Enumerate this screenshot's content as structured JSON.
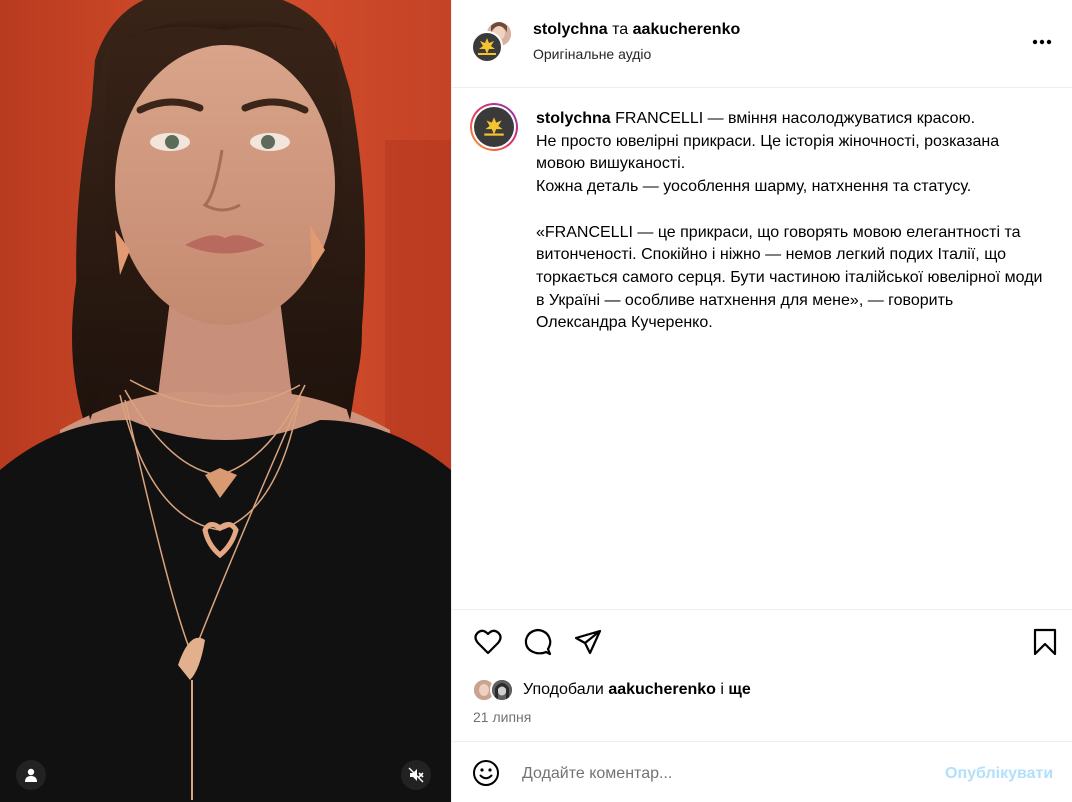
{
  "header": {
    "author": "stolychna",
    "conjunction": "та",
    "coauthor": "aakucherenko",
    "audio": "Оригінальне аудіо"
  },
  "caption": {
    "username": "stolychna",
    "lines1": [
      "FRANCELLI — вміння насолоджуватися красою.",
      "Не просто ювелірні прикраси. Це історія жіночності, розказана мовою вишуканості.",
      "Кожна деталь — уособлення шарму, натхнення та статусу."
    ],
    "quote": "«FRANCELLI — це прикраси, що говорять мовою елегантності та витонченості. Спокійно і ніжно — немов легкий подих Італії, що торкається самого серця. Бути частиною італійської ювелірної моди в Україні — особливе натхнення для мене», — говорить Олександра Кучеренко."
  },
  "likes": {
    "prefix": "Уподобали",
    "user": "aakucherenko",
    "and": "і",
    "more": "ще"
  },
  "date": "21 липня",
  "comment": {
    "placeholder": "Додайте коментар...",
    "publish": "Опублікувати"
  },
  "icons": {
    "like": "heart-icon",
    "comment": "comment-icon",
    "share": "share-icon",
    "save": "bookmark-icon",
    "emoji": "emoji-icon",
    "more": "more-icon",
    "user": "user-icon",
    "mute": "mute-icon"
  },
  "colors": {
    "publish_disabled": "#b2dffc",
    "secondary_text": "#737373",
    "background_red": "#c9482a"
  }
}
